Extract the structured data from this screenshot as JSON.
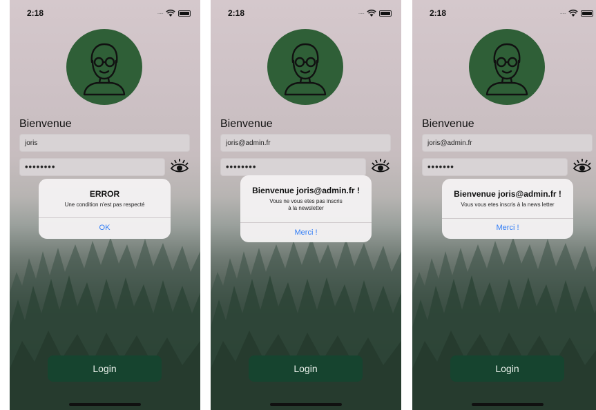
{
  "screens": [
    {
      "status": {
        "time": "2:18"
      },
      "welcome": "Bienvenue",
      "username": "joris",
      "password": "••••••••",
      "alert": {
        "title": "ERROR",
        "message": "Une condition n'est pas respecté",
        "button": "OK"
      },
      "login": "Login"
    },
    {
      "status": {
        "time": "2:18"
      },
      "welcome": "Bienvenue",
      "username": "joris@admin.fr",
      "password": "••••••••",
      "alert": {
        "title": "Bienvenue joris@admin.fr !",
        "message": "Vous ne vous etes pas inscris à la newsletter",
        "button": "Merci !"
      },
      "login": "Login"
    },
    {
      "status": {
        "time": "2:18"
      },
      "welcome": "Bienvenue",
      "username": "joris@admin.fr",
      "password": "•••••••",
      "alert": {
        "title": "Bienvenue joris@admin.fr !",
        "message": "Vous vous etes inscris à la news letter",
        "button": "Merci !"
      },
      "login": "Login"
    }
  ],
  "colors": {
    "avatar": "#2f5f37",
    "login": "#16442f",
    "alert_button": "#2f7cf6"
  },
  "icons": [
    "wifi-icon",
    "battery-icon",
    "user-avatar-icon",
    "eye-icon"
  ]
}
